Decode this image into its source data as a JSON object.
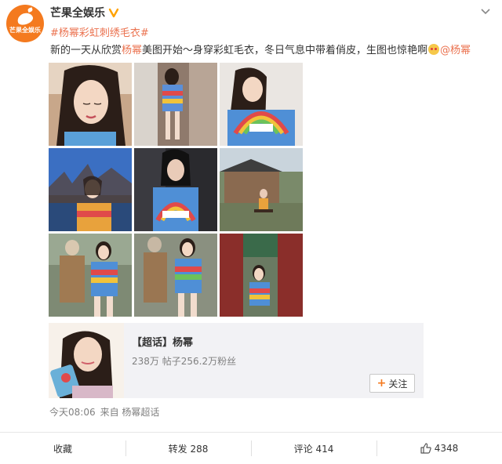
{
  "account": {
    "avatar_text": "芒果全娱乐",
    "name": "芒果全娱乐"
  },
  "post": {
    "topic": "#杨幂彩虹刺绣毛衣#",
    "text_before": "新的一天从欣赏",
    "text_highlight": "杨幂",
    "text_after": "美图开始～身穿彩虹毛衣，冬日气息中带着俏皮，生图也惊艳啊",
    "mention": "@杨幂"
  },
  "super_topic": {
    "title": "【超话】杨幂",
    "stats": "238万 帖子256.2万粉丝",
    "follow_label": "关注"
  },
  "meta": {
    "time": "今天08:06",
    "source": "来自 杨幂超话"
  },
  "actions": {
    "collect": "收藏",
    "repost": "转发 288",
    "comment": "评论 414",
    "like": "4348"
  },
  "colors": {
    "brand": "#f47a1f",
    "link": "#eb7350",
    "verified": "#ffa200"
  }
}
